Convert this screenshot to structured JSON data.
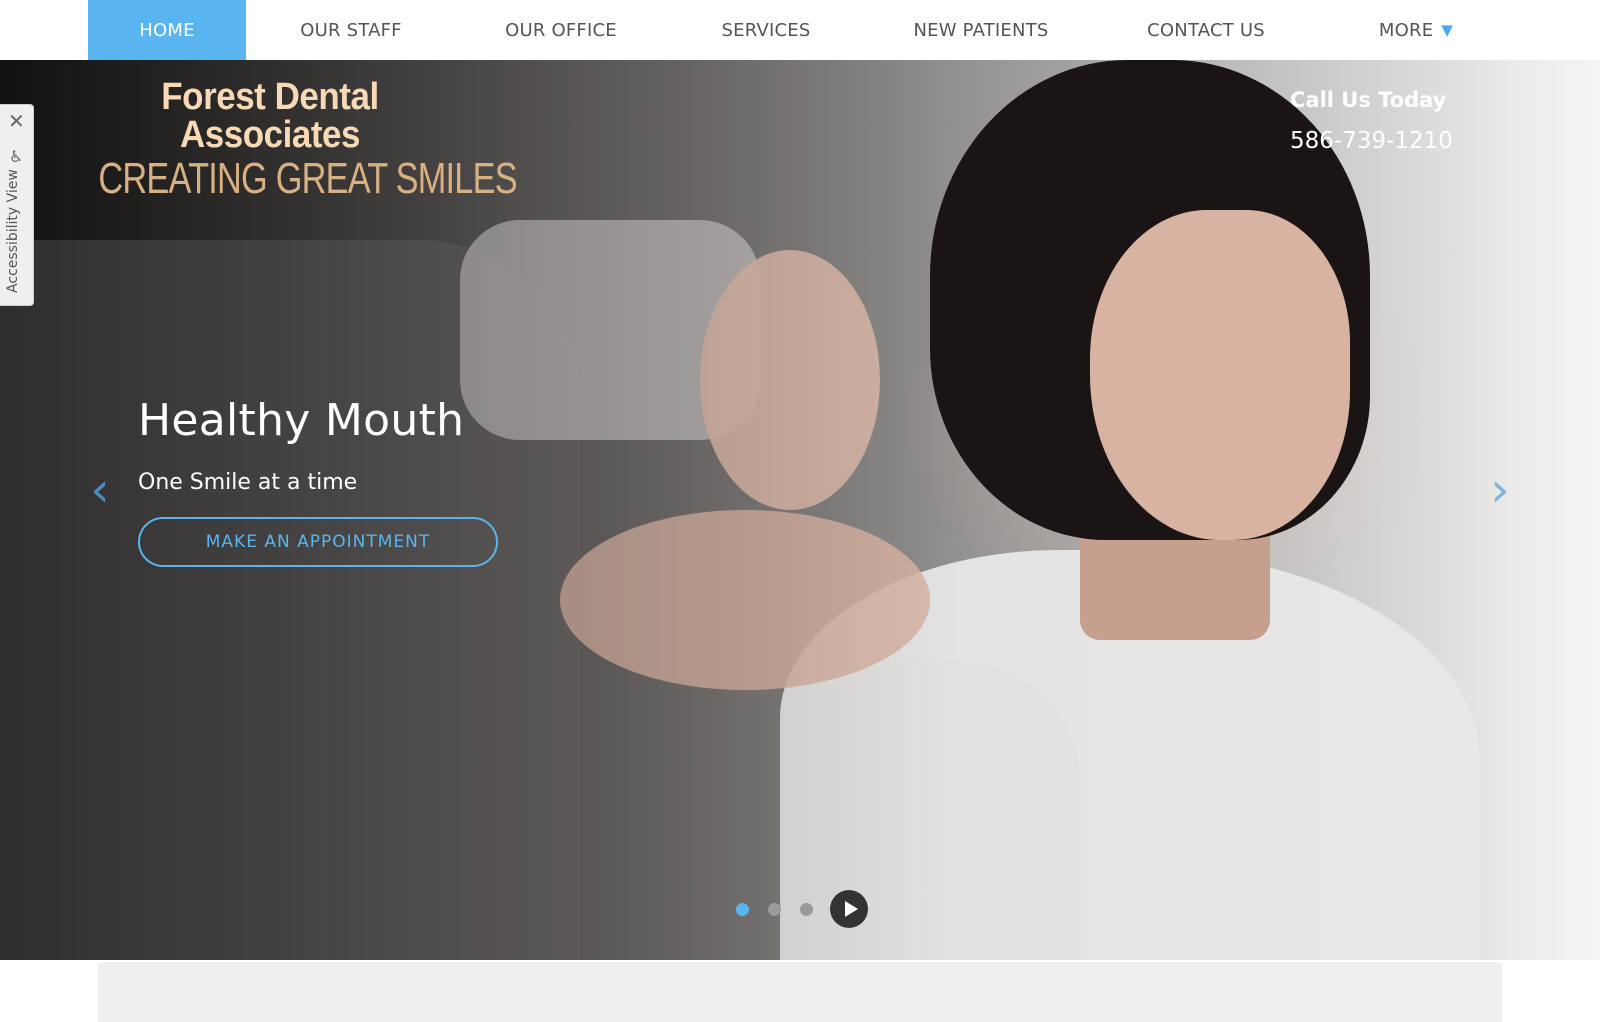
{
  "nav": {
    "items": [
      {
        "label": "HOME",
        "active": true
      },
      {
        "label": "OUR STAFF"
      },
      {
        "label": "OUR OFFICE"
      },
      {
        "label": "SERVICES"
      },
      {
        "label": "NEW PATIENTS"
      },
      {
        "label": "CONTACT US"
      },
      {
        "label": "MORE"
      }
    ],
    "more_icon": "triangle-down-icon"
  },
  "logo": {
    "line1": "Forest Dental",
    "line2": "Associates",
    "line3": "CREATING GREAT SMILES"
  },
  "call": {
    "title": "Call Us Today",
    "phone": "586-739-1210"
  },
  "accessibility": {
    "label": "Accessibility View",
    "close_icon": "close-icon",
    "icon": "wheelchair-icon"
  },
  "slide": {
    "title": "Healthy Mouth",
    "subtitle": "One Smile at a time",
    "cta_label": "MAKE AN APPOINTMENT"
  },
  "carousel": {
    "slide_count": 3,
    "active_index": 0
  },
  "colors": {
    "accent": "#5ab4f0",
    "nav_text": "#555555",
    "logo_cream": "#f7d9b5",
    "logo_gold": "#d9b082"
  }
}
